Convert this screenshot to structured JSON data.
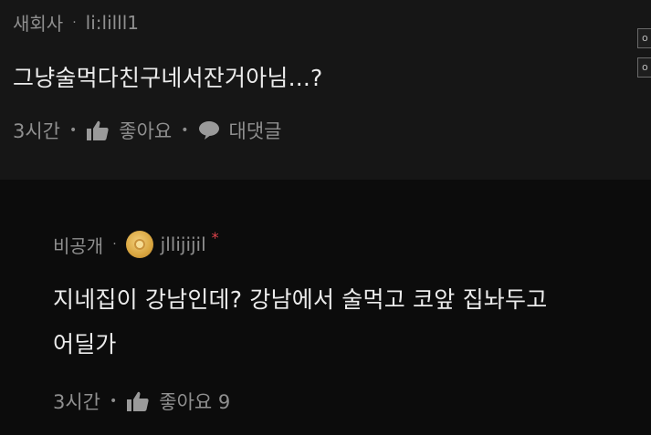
{
  "top_comment": {
    "author": "새회사",
    "separator": "·",
    "username": "li:lilll1",
    "text": "그냥술먹다친구네서잔거아님...?",
    "time": "3시간",
    "like_label": "좋아요",
    "reply_label": "대댓글"
  },
  "reply_comment": {
    "author": "비공개",
    "separator": "·",
    "username": "jllijijil",
    "star": "*",
    "text_line1": "지네집이 강남인데? 강남에서 술먹고 코앞 집놔두고",
    "text_line2": "어딜가",
    "time": "3시간",
    "like_label": "좋아요 9"
  },
  "edge_buttons": [
    "o",
    "o"
  ],
  "icons": {
    "like": "thumbs-up-icon",
    "reply": "speech-bubble-icon",
    "badge": "gold-badge-icon"
  },
  "colors": {
    "top_bg": "#161616",
    "reply_bg": "#0c0c0c",
    "meta_text": "#8f8f8f",
    "body_text": "#ececec",
    "star": "#e0434c"
  }
}
